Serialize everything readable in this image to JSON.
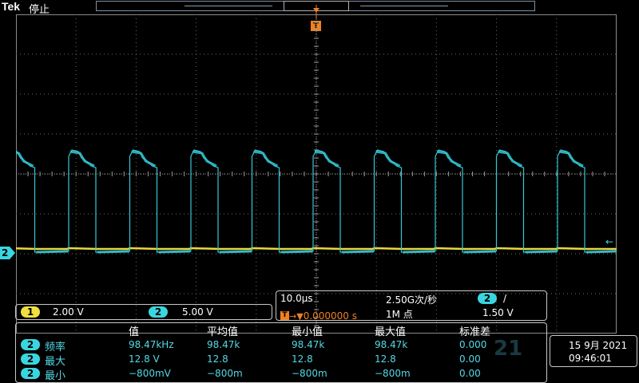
{
  "header": {
    "brand": "Tek",
    "run_state": "停止"
  },
  "trigger_marker": {
    "label": "T"
  },
  "channels": [
    {
      "num": "1",
      "scale": "2.00 V",
      "color": "#f0e040"
    },
    {
      "num": "2",
      "scale": "5.00 V",
      "color": "#3ad6e0"
    }
  ],
  "ch2_ground_marker": {
    "label": "2"
  },
  "timebase": {
    "scale": "10.0μs",
    "sample_rate": "2.50G次/秒",
    "position": "0.000000 s",
    "record_length": "1M 点",
    "trigger_source": "2",
    "trigger_slope": "/",
    "trigger_level": "1.50 V"
  },
  "measurements": {
    "headers": [
      "值",
      "平均值",
      "最小值",
      "最大值",
      "标准差"
    ],
    "rows": [
      {
        "ch": "2",
        "name": "频率",
        "value": "98.47kHz",
        "mean": "98.47k",
        "min": "98.47k",
        "max": "98.47k",
        "std": "0.000"
      },
      {
        "ch": "2",
        "name": "最大",
        "value": "12.8 V",
        "mean": "12.8",
        "min": "12.8",
        "max": "12.8",
        "std": "0.00"
      },
      {
        "ch": "2",
        "name": "最小",
        "value": "−800mV",
        "mean": "−800m",
        "min": "−800m",
        "max": "−800m",
        "std": "0.00"
      }
    ]
  },
  "datetime": {
    "date": "15 9月 2021",
    "time": "09:46:01"
  },
  "watermark": "21",
  "waveforms": {
    "ch1": {
      "color": "#e8d840"
    },
    "ch2": {
      "color": "#35c8d6"
    }
  }
}
